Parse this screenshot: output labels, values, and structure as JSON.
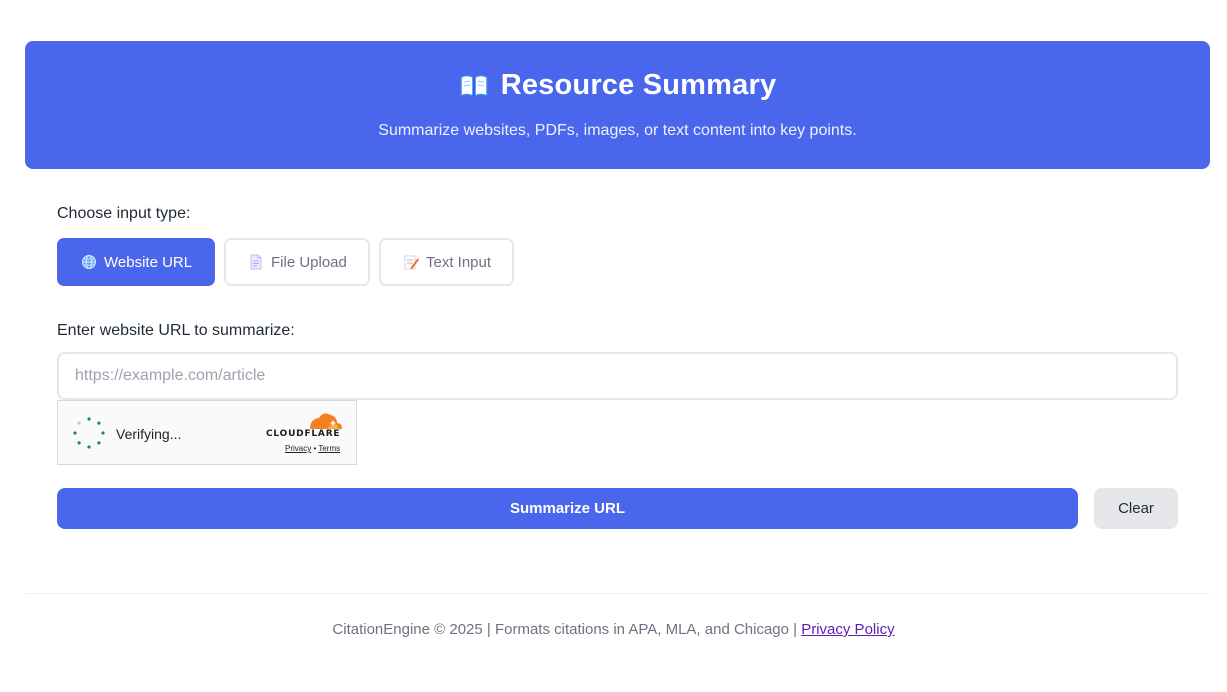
{
  "header": {
    "icon": "open-book-icon",
    "title": "Resource Summary",
    "subtitle": "Summarize websites, PDFs, images, or text content into key points."
  },
  "input_type": {
    "label": "Choose input type:",
    "tabs": [
      {
        "label": "Website URL",
        "icon": "globe-icon",
        "active": true
      },
      {
        "label": "File Upload",
        "icon": "document-icon",
        "active": false
      },
      {
        "label": "Text Input",
        "icon": "memo-icon",
        "active": false
      }
    ]
  },
  "url_form": {
    "label": "Enter website URL to summarize:",
    "placeholder": "https://example.com/article",
    "value": ""
  },
  "captcha": {
    "status": "Verifying...",
    "brand": "CLOUDFLARE",
    "privacy": "Privacy",
    "separator": "•",
    "terms": "Terms"
  },
  "actions": {
    "submit_label": "Summarize URL",
    "clear_label": "Clear"
  },
  "footer": {
    "text": "CitationEngine © 2025 | Formats citations in APA, MLA, and Chicago | ",
    "link": "Privacy Policy"
  },
  "colors": {
    "primary": "#4a66ec",
    "link": "#5b21b6",
    "cloudflare_orange": "#f48120"
  }
}
